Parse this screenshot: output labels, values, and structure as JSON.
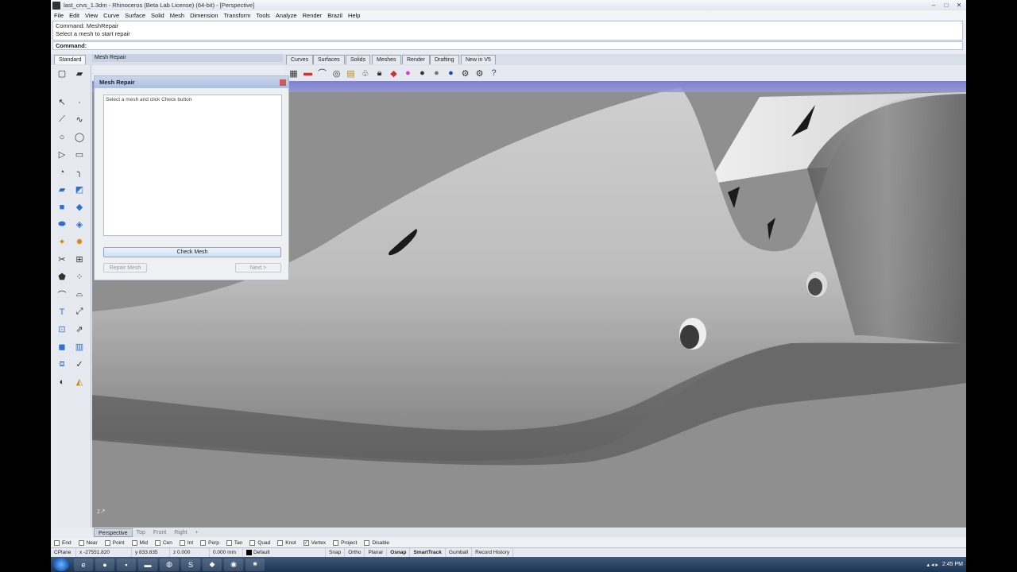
{
  "window": {
    "title": "last_crvs_1.3dm - Rhinoceros (Beta Lab License) (64-bit) - [Perspective]",
    "controls": [
      "–",
      "□",
      "✕"
    ]
  },
  "menu": [
    "File",
    "Edit",
    "View",
    "Curve",
    "Surface",
    "Solid",
    "Mesh",
    "Dimension",
    "Transform",
    "Tools",
    "Analyze",
    "Render",
    "Brazil",
    "Help"
  ],
  "command": {
    "history": [
      "Command: MeshRepair",
      "Select a mesh to start repair"
    ],
    "prompt": "Command:"
  },
  "toolbar_tabs": {
    "standard": "Standard",
    "panel_tab": "Mesh Repair",
    "tabs": [
      "Curves",
      "Surfaces",
      "Solids",
      "Meshes",
      "Render",
      "Drafting",
      "New in V5"
    ]
  },
  "mesh_repair": {
    "title": "Mesh Repair",
    "instruction": "Select a mesh and click Check button",
    "check_button": "Check Mesh",
    "repair_button": "Repair Mesh",
    "next_button": "Next >"
  },
  "viewport_tabs": [
    "Perspective",
    "Top",
    "Front",
    "Right",
    "+"
  ],
  "osnap": [
    {
      "label": "End",
      "checked": false
    },
    {
      "label": "Near",
      "checked": false
    },
    {
      "label": "Point",
      "checked": false
    },
    {
      "label": "Mid",
      "checked": false
    },
    {
      "label": "Cen",
      "checked": false
    },
    {
      "label": "Int",
      "checked": false
    },
    {
      "label": "Perp",
      "checked": false
    },
    {
      "label": "Tan",
      "checked": false
    },
    {
      "label": "Quad",
      "checked": false
    },
    {
      "label": "Knot",
      "checked": false
    },
    {
      "label": "Vertex",
      "checked": true
    },
    {
      "label": "Project",
      "checked": false
    },
    {
      "label": "Disable",
      "checked": false
    }
  ],
  "status": {
    "cplane": "CPlane",
    "x": "x -27551.820",
    "y": "y 833.835",
    "z": "z 0.000",
    "units": "0.000 mm",
    "layer": "Default",
    "toggles": [
      "Snap",
      "Ortho",
      "Planar",
      "Osnap",
      "SmartTrack",
      "Gumball",
      "Record History"
    ]
  },
  "taskbar": {
    "clock": "2:45 PM"
  },
  "colors": {
    "viewport_bg": "#8f8f8f",
    "viewport_title": "#8588dc",
    "mesh_light": "#d8d8d8",
    "mesh_dark": "#3a3a3a"
  }
}
